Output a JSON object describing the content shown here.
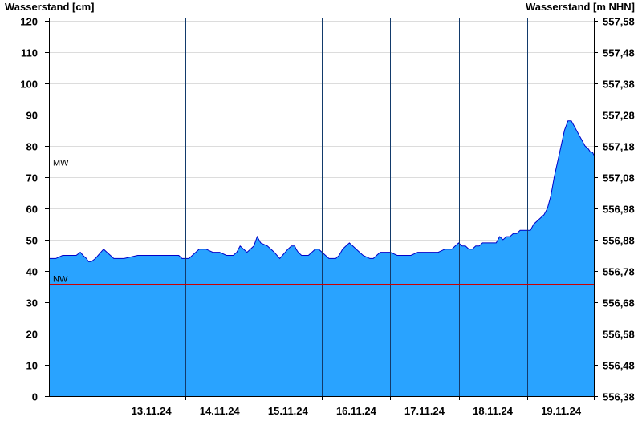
{
  "chart_data": {
    "type": "area",
    "ylabel_left": "Wasserstand [cm]",
    "ylabel_right": "Wasserstand [m NHN]",
    "ylim": [
      0,
      121
    ],
    "y_ticks_left": [
      "0",
      "10",
      "20",
      "30",
      "40",
      "50",
      "60",
      "70",
      "80",
      "90",
      "100",
      "110",
      "120"
    ],
    "y_ticks_right": [
      "556,38",
      "556,48",
      "556,58",
      "556,68",
      "556,78",
      "556,88",
      "556,98",
      "557,08",
      "557,18",
      "557,28",
      "557,38",
      "557,48",
      "557,58"
    ],
    "x_range_days": [
      12.0,
      19.98
    ],
    "x_day_starts": [
      13,
      14,
      15,
      16,
      17,
      18,
      19
    ],
    "x_labels": [
      "13.11.24",
      "14.11.24",
      "15.11.24",
      "16.11.24",
      "17.11.24",
      "18.11.24",
      "19.11.24"
    ],
    "grid": true,
    "fill_color": "#29a3ff",
    "line_color": "#0000c8",
    "reference_lines": [
      {
        "label": "MW",
        "value": 73,
        "color": "#007a00"
      },
      {
        "label": "NW",
        "value": 36,
        "color": "#cc0000"
      }
    ],
    "series": [
      {
        "x": [
          12.0,
          12.1,
          12.2,
          12.3,
          12.4,
          12.46,
          12.5,
          12.55,
          12.58,
          12.62,
          12.68,
          12.72,
          12.76,
          12.8,
          12.85,
          12.9,
          12.95,
          13.0,
          13.1,
          13.3,
          13.5,
          13.7,
          13.8,
          13.85,
          13.9,
          13.95,
          14.0,
          14.05,
          14.1,
          14.15,
          14.2,
          14.3,
          14.4,
          14.5,
          14.6,
          14.7,
          14.75,
          14.8,
          14.85,
          14.9,
          14.95,
          15.0,
          15.05,
          15.1,
          15.2,
          15.3,
          15.38,
          15.42,
          15.46,
          15.5,
          15.55,
          15.6,
          15.62,
          15.65,
          15.7,
          15.8,
          15.85,
          15.9,
          15.95,
          16.0,
          16.05,
          16.1,
          16.2,
          16.25,
          16.3,
          16.35,
          16.4,
          16.45,
          16.5,
          16.55,
          16.6,
          16.7,
          16.75,
          16.8,
          16.85,
          16.9,
          16.95,
          17.0,
          17.1,
          17.2,
          17.3,
          17.4,
          17.5,
          17.6,
          17.7,
          17.8,
          17.9,
          17.95,
          18.0,
          18.05,
          18.1,
          18.15,
          18.2,
          18.25,
          18.3,
          18.35,
          18.4,
          18.45,
          18.5,
          18.55,
          18.6,
          18.65,
          18.7,
          18.75,
          18.8,
          18.85,
          18.9,
          18.95,
          19.0,
          19.05,
          19.1,
          19.15,
          19.2,
          19.25,
          19.3,
          19.35,
          19.4,
          19.45,
          19.5,
          19.55,
          19.6,
          19.65,
          19.7,
          19.75,
          19.8,
          19.85,
          19.9,
          19.93,
          19.96,
          19.98
        ],
        "values": [
          44,
          44,
          45,
          45,
          45,
          46,
          45,
          44,
          43,
          43,
          44,
          45,
          46,
          47,
          46,
          45,
          44,
          44,
          44,
          45,
          45,
          45,
          45,
          45,
          45,
          44,
          44,
          44,
          45,
          46,
          47,
          47,
          46,
          46,
          45,
          45,
          46,
          48,
          47,
          46,
          47,
          48,
          51,
          49,
          48,
          46,
          44,
          45,
          46,
          47,
          48,
          48,
          47,
          46,
          45,
          45,
          46,
          47,
          47,
          46,
          45,
          44,
          44,
          45,
          47,
          48,
          49,
          48,
          47,
          46,
          45,
          44,
          44,
          45,
          46,
          46,
          46,
          46,
          45,
          45,
          45,
          46,
          46,
          46,
          46,
          47,
          47,
          48,
          49,
          48,
          48,
          47,
          47,
          48,
          48,
          49,
          49,
          49,
          49,
          49,
          51,
          50,
          51,
          51,
          52,
          52,
          53,
          53,
          53,
          53,
          55,
          56,
          57,
          58,
          60,
          64,
          70,
          75,
          80,
          85,
          88,
          88,
          86,
          84,
          82,
          80,
          79,
          78,
          78,
          77
        ]
      }
    ]
  }
}
